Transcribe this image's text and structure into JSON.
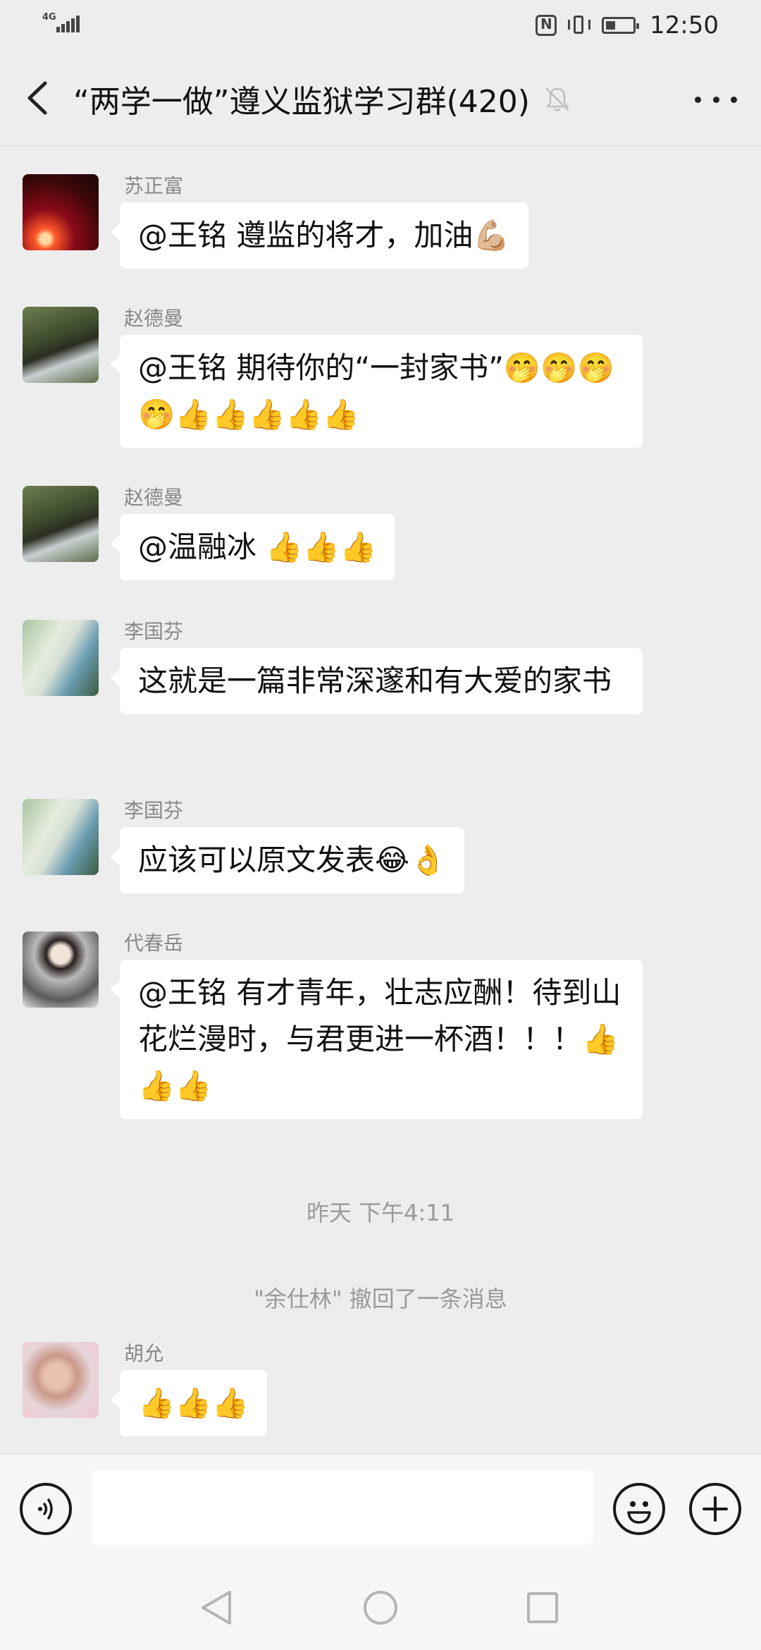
{
  "status_bar": {
    "network": "4G",
    "time": "12:50",
    "battery_level": 0.35
  },
  "header": {
    "title": "“两学一做”遵义监狱学习群(420)"
  },
  "messages": [
    {
      "sender": "苏正富",
      "text": "@王铭  遵监的将才，加油💪🏼"
    },
    {
      "sender": "赵德曼",
      "text": "@王铭  期待你的“一封家书”🤭🤭🤭🤭👍👍👍👍👍"
    },
    {
      "sender": "赵德曼",
      "text": "@温融冰  👍👍👍"
    },
    {
      "sender": "李国芬",
      "text": "这就是一篇非常深邃和有大爱的家书"
    },
    {
      "sender": "李国芬",
      "text": "应该可以原文发表😂👌"
    },
    {
      "sender": "代春岳",
      "text": "@王铭  有才青年，壮志应酬！待到山花烂漫时，与君更进一杯酒！！！👍👍👍"
    },
    {
      "sender": "胡允",
      "text": "👍👍👍"
    }
  ],
  "system_messages": {
    "timestamp": "昨天 下午4:11",
    "recall_notice": "\"余仕林\" 撤回了一条消息"
  },
  "input": {
    "placeholder": ""
  },
  "icons": {
    "back": "back-arrow-icon",
    "mute": "bell-muted-icon",
    "more": "more-dots-icon",
    "voice": "voice-icon",
    "emoji": "emoji-icon",
    "plus": "plus-icon"
  },
  "colors": {
    "background": "#ededed",
    "bubble": "#ffffff",
    "meta_text": "#888888"
  }
}
